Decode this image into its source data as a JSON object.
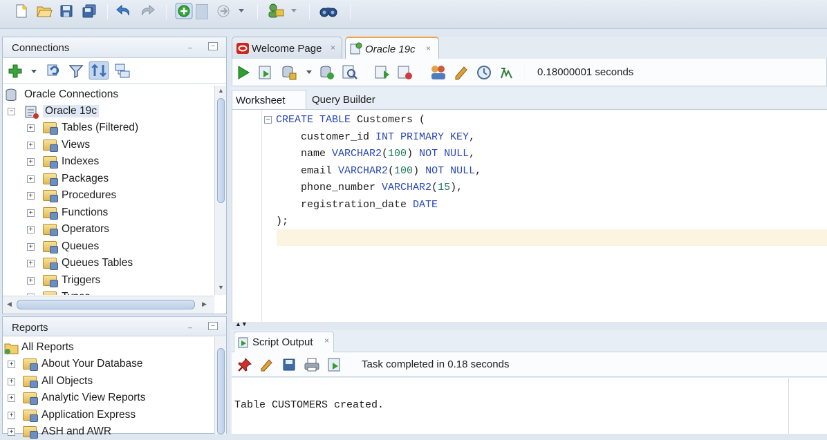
{
  "colors": {
    "keyword": "#2a47b8",
    "number": "#1d7a5a",
    "current_line": "#fbf4e0",
    "run_green": "#2e9e2e"
  },
  "main_toolbar": {
    "icons": [
      "new-icon",
      "open-icon",
      "save-icon",
      "save-all-icon",
      "undo-icon",
      "redo-icon",
      "back-icon",
      "forward-icon",
      "dropdown-icon",
      "debug-icon",
      "find-binoculars-icon"
    ]
  },
  "connections_panel": {
    "title": "Connections",
    "toolbar_icons": [
      "add-connection-icon",
      "dropdown-icon",
      "refresh-icon",
      "filter-icon",
      "schema-browser-icon",
      "connections-icon"
    ],
    "tree": {
      "root": "Oracle Connections",
      "connection": "Oracle 19c",
      "items": [
        {
          "label": "Tables (Filtered)"
        },
        {
          "label": "Views"
        },
        {
          "label": "Indexes"
        },
        {
          "label": "Packages"
        },
        {
          "label": "Procedures"
        },
        {
          "label": "Functions"
        },
        {
          "label": "Operators"
        },
        {
          "label": "Queues"
        },
        {
          "label": "Queues Tables"
        },
        {
          "label": "Triggers"
        },
        {
          "label": "Types"
        }
      ]
    }
  },
  "reports_panel": {
    "title": "Reports",
    "root": "All Reports",
    "items": [
      {
        "label": "About Your Database"
      },
      {
        "label": "All Objects"
      },
      {
        "label": "Analytic View Reports"
      },
      {
        "label": "Application Express"
      },
      {
        "label": "ASH and AWR"
      }
    ]
  },
  "tabs": [
    {
      "label": "Welcome Page",
      "active": false,
      "icon": "oracle-logo-icon"
    },
    {
      "label": "Oracle 19c",
      "active": true,
      "icon": "sql-worksheet-icon"
    }
  ],
  "worksheet": {
    "toolbar_icons": [
      "run-statement-icon",
      "run-script-icon",
      "commit-icon",
      "rollback-icon",
      "autotrace-icon",
      "explain-plan-icon",
      "sql-tuning-icon",
      "clear-icon",
      "history-icon",
      "format-icon"
    ],
    "elapsed": "0.18000001 seconds",
    "subtabs": [
      "Worksheet",
      "Query Builder"
    ],
    "code": [
      [
        {
          "t": "CREATE TABLE",
          "k": "kw"
        },
        {
          "t": " Customers ("
        }
      ],
      [
        {
          "t": "    customer_id "
        },
        {
          "t": "INT PRIMARY KEY",
          "k": "kw"
        },
        {
          "t": ","
        }
      ],
      [
        {
          "t": "    name "
        },
        {
          "t": "VARCHAR2",
          "k": "kw"
        },
        {
          "t": "("
        },
        {
          "t": "100",
          "k": "num"
        },
        {
          "t": ") "
        },
        {
          "t": "NOT NULL",
          "k": "kw"
        },
        {
          "t": ","
        }
      ],
      [
        {
          "t": "    email "
        },
        {
          "t": "VARCHAR2",
          "k": "kw"
        },
        {
          "t": "("
        },
        {
          "t": "100",
          "k": "num"
        },
        {
          "t": ") "
        },
        {
          "t": "NOT NULL",
          "k": "kw"
        },
        {
          "t": ","
        }
      ],
      [
        {
          "t": "    phone_number "
        },
        {
          "t": "VARCHAR2",
          "k": "kw"
        },
        {
          "t": "("
        },
        {
          "t": "15",
          "k": "num"
        },
        {
          "t": "),"
        }
      ],
      [
        {
          "t": "    registration_date "
        },
        {
          "t": "DATE",
          "k": "kw"
        }
      ],
      [
        {
          "t": ");"
        }
      ]
    ]
  },
  "script_output": {
    "tab_label": "Script Output",
    "toolbar_icons": [
      "pin-icon",
      "clear-icon",
      "save-icon",
      "print-icon",
      "run-script-icon"
    ],
    "status": "Task completed in 0.18 seconds",
    "text": "Table CUSTOMERS created."
  }
}
